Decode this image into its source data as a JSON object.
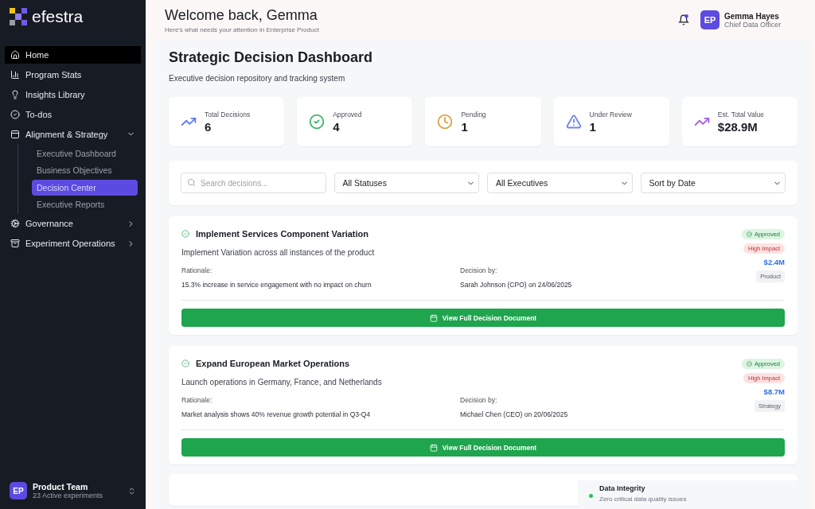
{
  "brand": {
    "name": "efestra"
  },
  "sidebar": {
    "items": [
      {
        "label": "Home",
        "selected": true
      },
      {
        "label": "Program Stats",
        "selected": false
      },
      {
        "label": "Insights Library",
        "selected": false
      },
      {
        "label": "To-dos",
        "selected": false
      },
      {
        "label": "Alignment & Strategy",
        "selected": false,
        "expanded": true,
        "children": [
          {
            "label": "Executive Dashboard",
            "selected": false
          },
          {
            "label": "Business Objectives",
            "selected": false
          },
          {
            "label": "Decision Center",
            "selected": true
          },
          {
            "label": "Executive Reports",
            "selected": false
          }
        ]
      },
      {
        "label": "Governance",
        "selected": false,
        "expanded": false
      },
      {
        "label": "Experiment Operations",
        "selected": false,
        "expanded": false
      }
    ],
    "team": {
      "initials": "EP",
      "name": "Product Team",
      "subtitle": "23 Active experiments"
    }
  },
  "header": {
    "title": "Welcome back, Gemma",
    "subtitle": "Here's what needs your attention in Enterprise Product",
    "notification_unread": true,
    "user": {
      "initials": "EP",
      "name": "Gemma Hayes",
      "role": "Chief Data Officer"
    }
  },
  "page": {
    "title": "Strategic Decision Dashboard",
    "subtitle": "Executive decision repository and tracking system"
  },
  "stats": [
    {
      "label": "Total Decisions",
      "value": "6",
      "color": "#5b7cf0"
    },
    {
      "label": "Approved",
      "value": "4",
      "color": "#3fb56a"
    },
    {
      "label": "Pending",
      "value": "1",
      "color": "#e3a046"
    },
    {
      "label": "Under Review",
      "value": "1",
      "color": "#6d85f0"
    },
    {
      "label": "Est. Total Value",
      "value": "$28.9M",
      "color": "#a15ee8"
    }
  ],
  "filters": {
    "search": {
      "placeholder": "Search decisions..."
    },
    "selects": [
      "All Statuses",
      "All Executives",
      "Sort by Date"
    ]
  },
  "decisions": [
    {
      "title": "Implement Services Component Variation",
      "description": "Implement Variation across all instances of the product",
      "rationale_label": "Rationale:",
      "rationale": "15.3% increase in service engagement with no impact on churn",
      "decision_by_label": "Decision by:",
      "decision_by": "Sarah Johnson (CPO) on 24/06/2025",
      "status": "Approved",
      "impact": "High Impact",
      "value": "$2.4M",
      "category": "Product",
      "button": "View Full Decision Document"
    },
    {
      "title": "Expand European Market Operations",
      "description": "Launch operations in Germany, France, and Netherlands",
      "rationale_label": "Rationale:",
      "rationale": "Market analysis shows 40% revenue growth potential in Q3-Q4",
      "decision_by_label": "Decision by:",
      "decision_by": "Michael Chen (CEO) on 20/06/2025",
      "status": "Approved",
      "impact": "High Impact",
      "value": "$8.7M",
      "category": "Strategy",
      "button": "View Full Decision Document"
    }
  ],
  "integrity": {
    "title": "Data Integrity",
    "text": "Zero critical data quality issues",
    "color": "#22c55e"
  }
}
